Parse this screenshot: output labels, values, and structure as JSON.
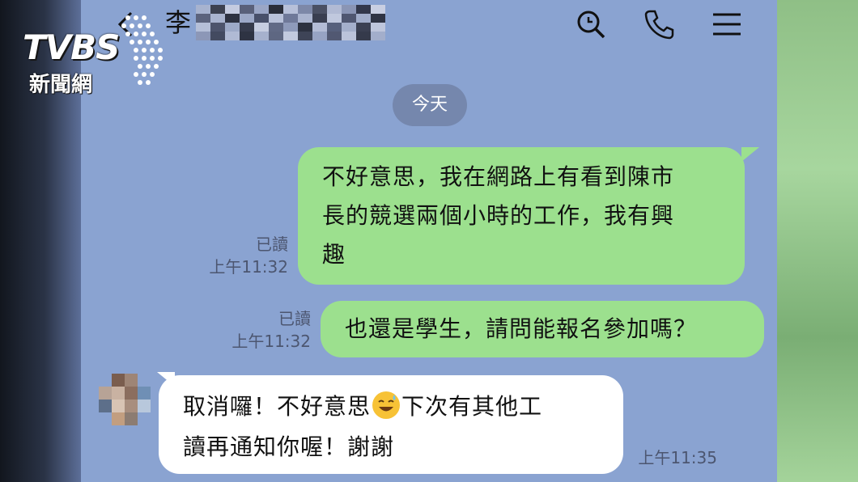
{
  "watermark": {
    "brand": "TVBS",
    "sub": "新聞網"
  },
  "header": {
    "contact_name_visible": "李",
    "icons": [
      "back-icon",
      "search-icon",
      "phone-icon",
      "menu-icon"
    ]
  },
  "date_chip": "今天",
  "messages": [
    {
      "side": "sent",
      "lines": [
        "不好意思，我在網路上有看到陳市",
        "長的競選兩個小時的工作，我有興",
        "趣"
      ],
      "read": "已讀",
      "time": "上午11:32"
    },
    {
      "side": "sent",
      "lines": [
        "也還是學生，請問能報名參加嗎？"
      ],
      "read": "已讀",
      "time": "上午11:32"
    },
    {
      "side": "received",
      "line1_a": "取消囉！不好意思",
      "emoji": "sweat-smile-emoji",
      "line1_b": "下次有其他工",
      "line2": "讀再通知你喔！謝謝",
      "time": "上午11:35"
    }
  ],
  "colors": {
    "chat_bg": "#8aa3d1",
    "sent_bubble": "#9ce08e",
    "received_bubble": "#ffffff",
    "date_chip": "#7587ad"
  }
}
